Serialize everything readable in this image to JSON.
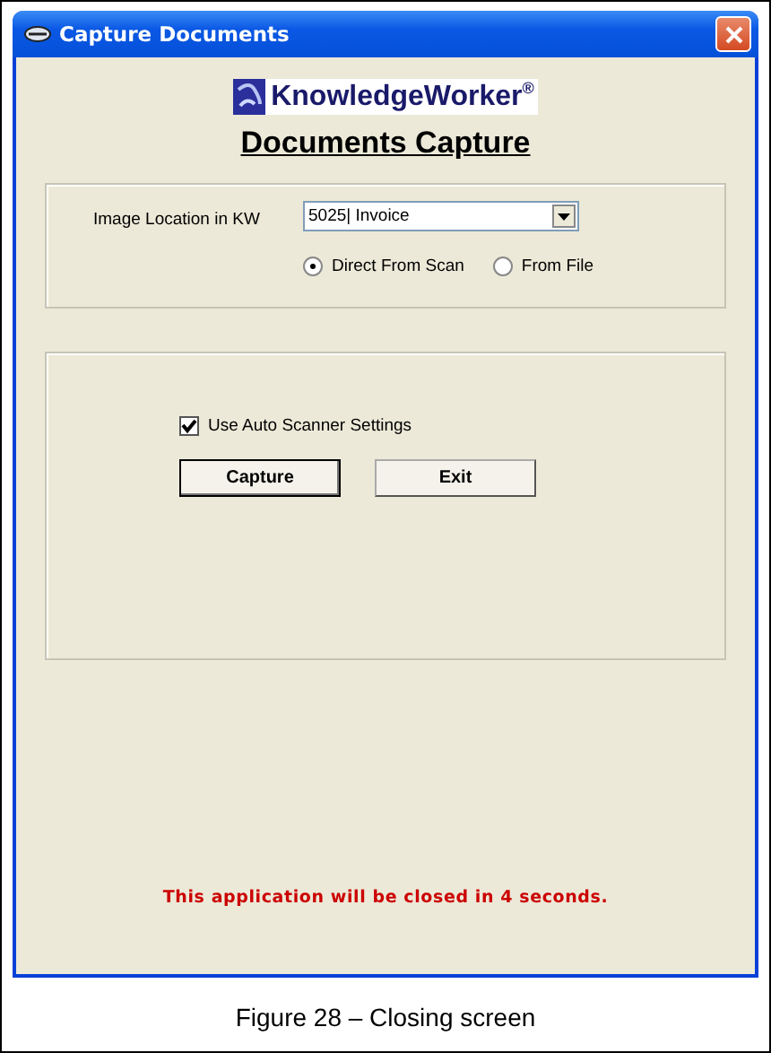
{
  "window": {
    "title": "Capture Documents"
  },
  "logo": {
    "text": "KnowledgeWorker$^{®}$"
  },
  "heading": "Documents Capture",
  "location": {
    "label": "Image Location in KW",
    "value": "5025| Invoice"
  },
  "sources": [
    {
      "label": "Direct From Scan",
      "selected": true
    },
    {
      "label": "From File",
      "selected": false
    }
  ],
  "auto_settings": {
    "label": "Use Auto Scanner Settings",
    "checked": true
  },
  "buttons": [
    {
      "label": "Capture",
      "default": true
    },
    {
      "label": "Exit",
      "default": false
    }
  ],
  "message": "This application will be closed in 4 seconds.",
  "caption": "Figure 28 – Closing screen"
}
